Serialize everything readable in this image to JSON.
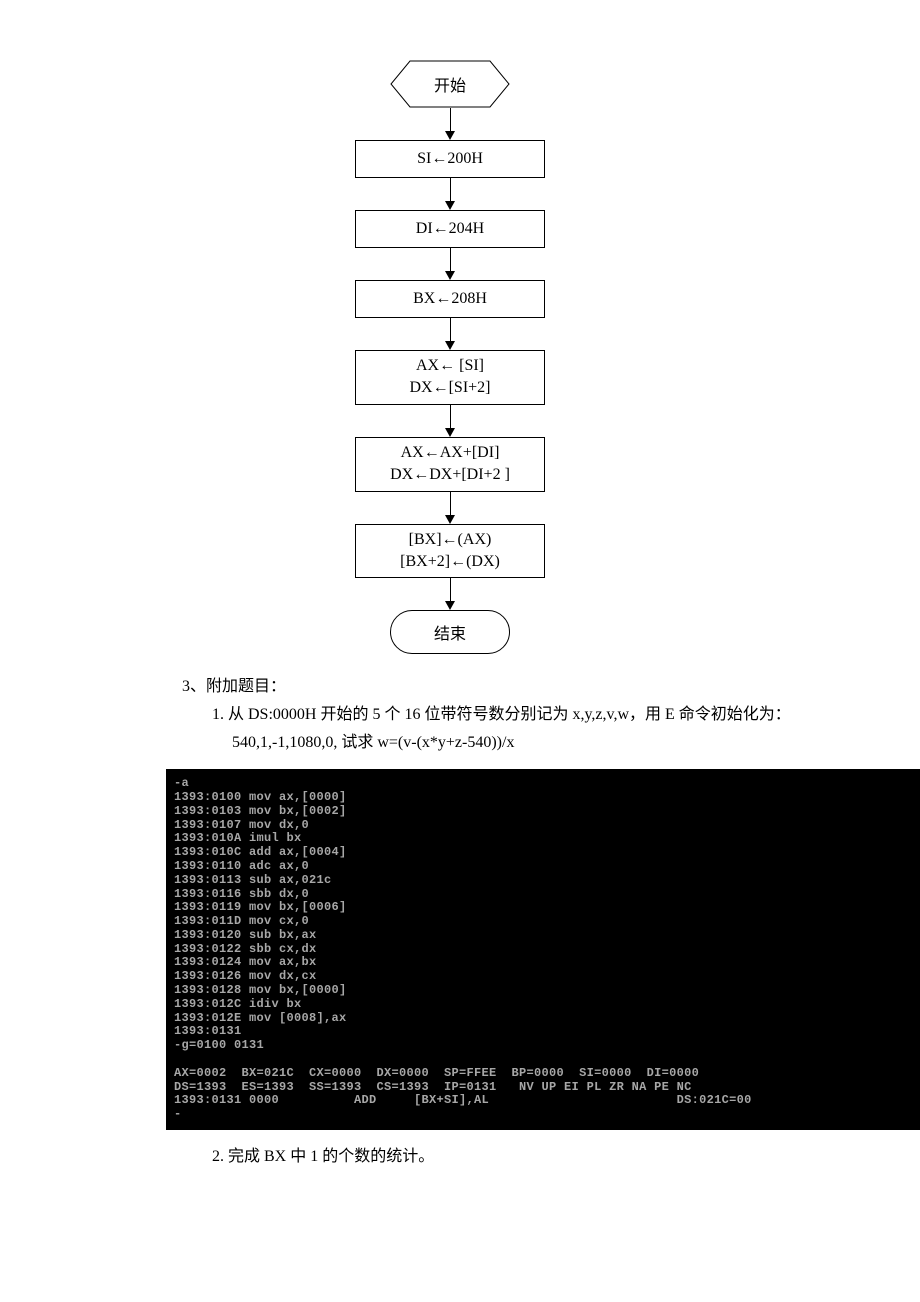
{
  "flowchart": {
    "start": "开始",
    "steps": [
      {
        "lines": [
          "SI←200H"
        ]
      },
      {
        "lines": [
          "DI←204H"
        ]
      },
      {
        "lines": [
          "BX←208H"
        ]
      },
      {
        "lines": [
          "AX←  [SI]",
          "DX←[SI+2]"
        ]
      },
      {
        "lines": [
          "AX←AX+[DI]",
          "DX←DX+[DI+2 ]"
        ]
      },
      {
        "lines": [
          "[BX]←(AX)",
          "[BX+2]←(DX)"
        ]
      }
    ],
    "end": "结束"
  },
  "questions": {
    "heading": "3、附加题目：",
    "q1_a": "1.    从 DS:0000H 开始的 5 个 16 位带符号数分别记为 x,y,z,v,w，用 E 命令初始化为：",
    "q1_b": "540,1,-1,1080,0,    试求 w=(v-(x*y+z-540))/x",
    "q2": "2.    完成 BX 中 1 的个数的统计。"
  },
  "terminal": {
    "lines": [
      "-a",
      "1393:0100 mov ax,[0000]",
      "1393:0103 mov bx,[0002]",
      "1393:0107 mov dx,0",
      "1393:010A imul bx",
      "1393:010C add ax,[0004]",
      "1393:0110 adc ax,0",
      "1393:0113 sub ax,021c",
      "1393:0116 sbb dx,0",
      "1393:0119 mov bx,[0006]",
      "1393:011D mov cx,0",
      "1393:0120 sub bx,ax",
      "1393:0122 sbb cx,dx",
      "1393:0124 mov ax,bx",
      "1393:0126 mov dx,cx",
      "1393:0128 mov bx,[0000]",
      "1393:012C idiv bx",
      "1393:012E mov [0008],ax",
      "1393:0131",
      "-g=0100 0131",
      "",
      "AX=0002  BX=021C  CX=0000  DX=0000  SP=FFEE  BP=0000  SI=0000  DI=0000",
      "DS=1393  ES=1393  SS=1393  CS=1393  IP=0131   NV UP EI PL ZR NA PE NC",
      "1393:0131 0000          ADD     [BX+SI],AL                         DS:021C=00",
      "-"
    ]
  },
  "chart_data": {
    "type": "flowchart",
    "nodes": [
      {
        "id": "start",
        "shape": "terminator-hex",
        "label": "开始"
      },
      {
        "id": "n1",
        "shape": "process",
        "label": "SI←200H"
      },
      {
        "id": "n2",
        "shape": "process",
        "label": "DI←204H"
      },
      {
        "id": "n3",
        "shape": "process",
        "label": "BX←208H"
      },
      {
        "id": "n4",
        "shape": "process",
        "label": "AX←[SI]; DX←[SI+2]"
      },
      {
        "id": "n5",
        "shape": "process",
        "label": "AX←AX+[DI]; DX←DX+[DI+2]"
      },
      {
        "id": "n6",
        "shape": "process",
        "label": "[BX]←(AX); [BX+2]←(DX)"
      },
      {
        "id": "end",
        "shape": "terminator",
        "label": "结束"
      }
    ],
    "edges": [
      [
        "start",
        "n1"
      ],
      [
        "n1",
        "n2"
      ],
      [
        "n2",
        "n3"
      ],
      [
        "n3",
        "n4"
      ],
      [
        "n4",
        "n5"
      ],
      [
        "n5",
        "n6"
      ],
      [
        "n6",
        "end"
      ]
    ]
  }
}
